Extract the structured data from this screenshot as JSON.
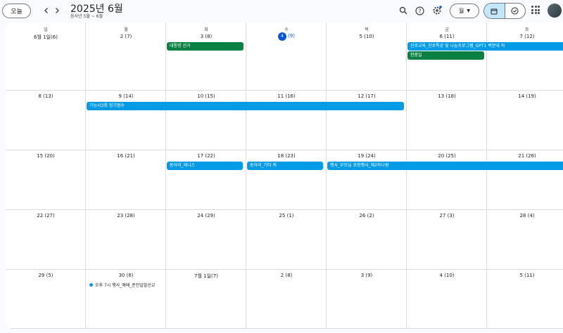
{
  "header": {
    "today_label": "오늘",
    "prev_icon": "chevron-left-icon",
    "next_icon": "chevron-right-icon",
    "title": "2025년 6월",
    "subtitle": "음사년 5월 ~ 6월",
    "view_label": "월",
    "icons": [
      "search-icon",
      "help-icon",
      "settings-icon",
      "calendar-icon",
      "tasks-icon",
      "apps-icon"
    ]
  },
  "days_of_week": [
    "일",
    "월",
    "화",
    "수",
    "목",
    "금",
    "토"
  ],
  "weeks": [
    [
      "6월 1일(6)",
      "2 (7)",
      "3 (8)",
      "4",
      "5 (10)",
      "6 (11)",
      "7 (12)"
    ],
    [
      "8 (13)",
      "9 (14)",
      "10 (15)",
      "11 (16)",
      "12 (17)",
      "13 (18)",
      "14 (19)"
    ],
    [
      "15 (20)",
      "16 (21)",
      "17 (22)",
      "18 (23)",
      "19 (24)",
      "20 (25)",
      "21 (26)"
    ],
    [
      "22 (27)",
      "23 (28)",
      "24 (29)",
      "25 (1)",
      "26 (2)",
      "27 (3)",
      "28 (4)"
    ],
    [
      "29 (5)",
      "30 (6)",
      "7월 1일(7)",
      "2 (8)",
      "3 (9)",
      "4 (10)",
      "5 (11)"
    ]
  ],
  "today_extra": "(9)",
  "events": {
    "election": "대통령 선거",
    "career": "진로교육_진로특강 및 나눔프로그램_GPT1 백문대 외",
    "memorial": "현충일",
    "exam": "기능사3회 정기점수",
    "club_tennis": "동아리_테니스",
    "club_guitar": "동아리_기타 외",
    "parents": "행사_부모님 초청행사_제2하나원",
    "worship": "오후 7시 행사_예배_준전일말선교"
  }
}
